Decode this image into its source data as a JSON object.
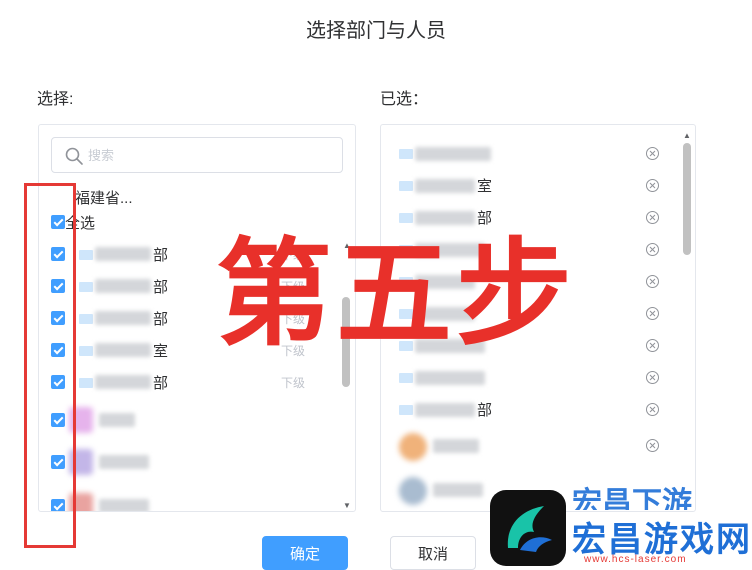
{
  "dialog": {
    "title": "选择部门与人员"
  },
  "left": {
    "label": "选择:",
    "search_placeholder": "搜索",
    "breadcrumb": "福建省...",
    "select_all": "全选",
    "rows": [
      {
        "suffix": "部",
        "sub": "下级"
      },
      {
        "suffix": "部",
        "sub": "下级"
      },
      {
        "suffix": "部",
        "sub": "下级"
      },
      {
        "suffix": "室",
        "sub": "下级"
      },
      {
        "suffix": "部",
        "sub": "下级"
      }
    ]
  },
  "right": {
    "label": "已选：",
    "rows": [
      {
        "suffix": ""
      },
      {
        "suffix": "室"
      },
      {
        "suffix": "部"
      },
      {
        "suffix": ""
      },
      {
        "suffix": ""
      },
      {
        "suffix": ""
      },
      {
        "suffix": ""
      },
      {
        "suffix": ""
      },
      {
        "suffix": "部"
      }
    ]
  },
  "annotation": {
    "step_text": "第五步"
  },
  "buttons": {
    "confirm": "确定",
    "cancel": "取消"
  },
  "watermark": {
    "top_text": "宏昌下游",
    "main_text": "宏昌游戏网",
    "url": "www.hcs-laser.com"
  },
  "colors": {
    "primary": "#409eff",
    "annotation_red": "#e53935",
    "watermark_blue": "#1f6fd6"
  }
}
